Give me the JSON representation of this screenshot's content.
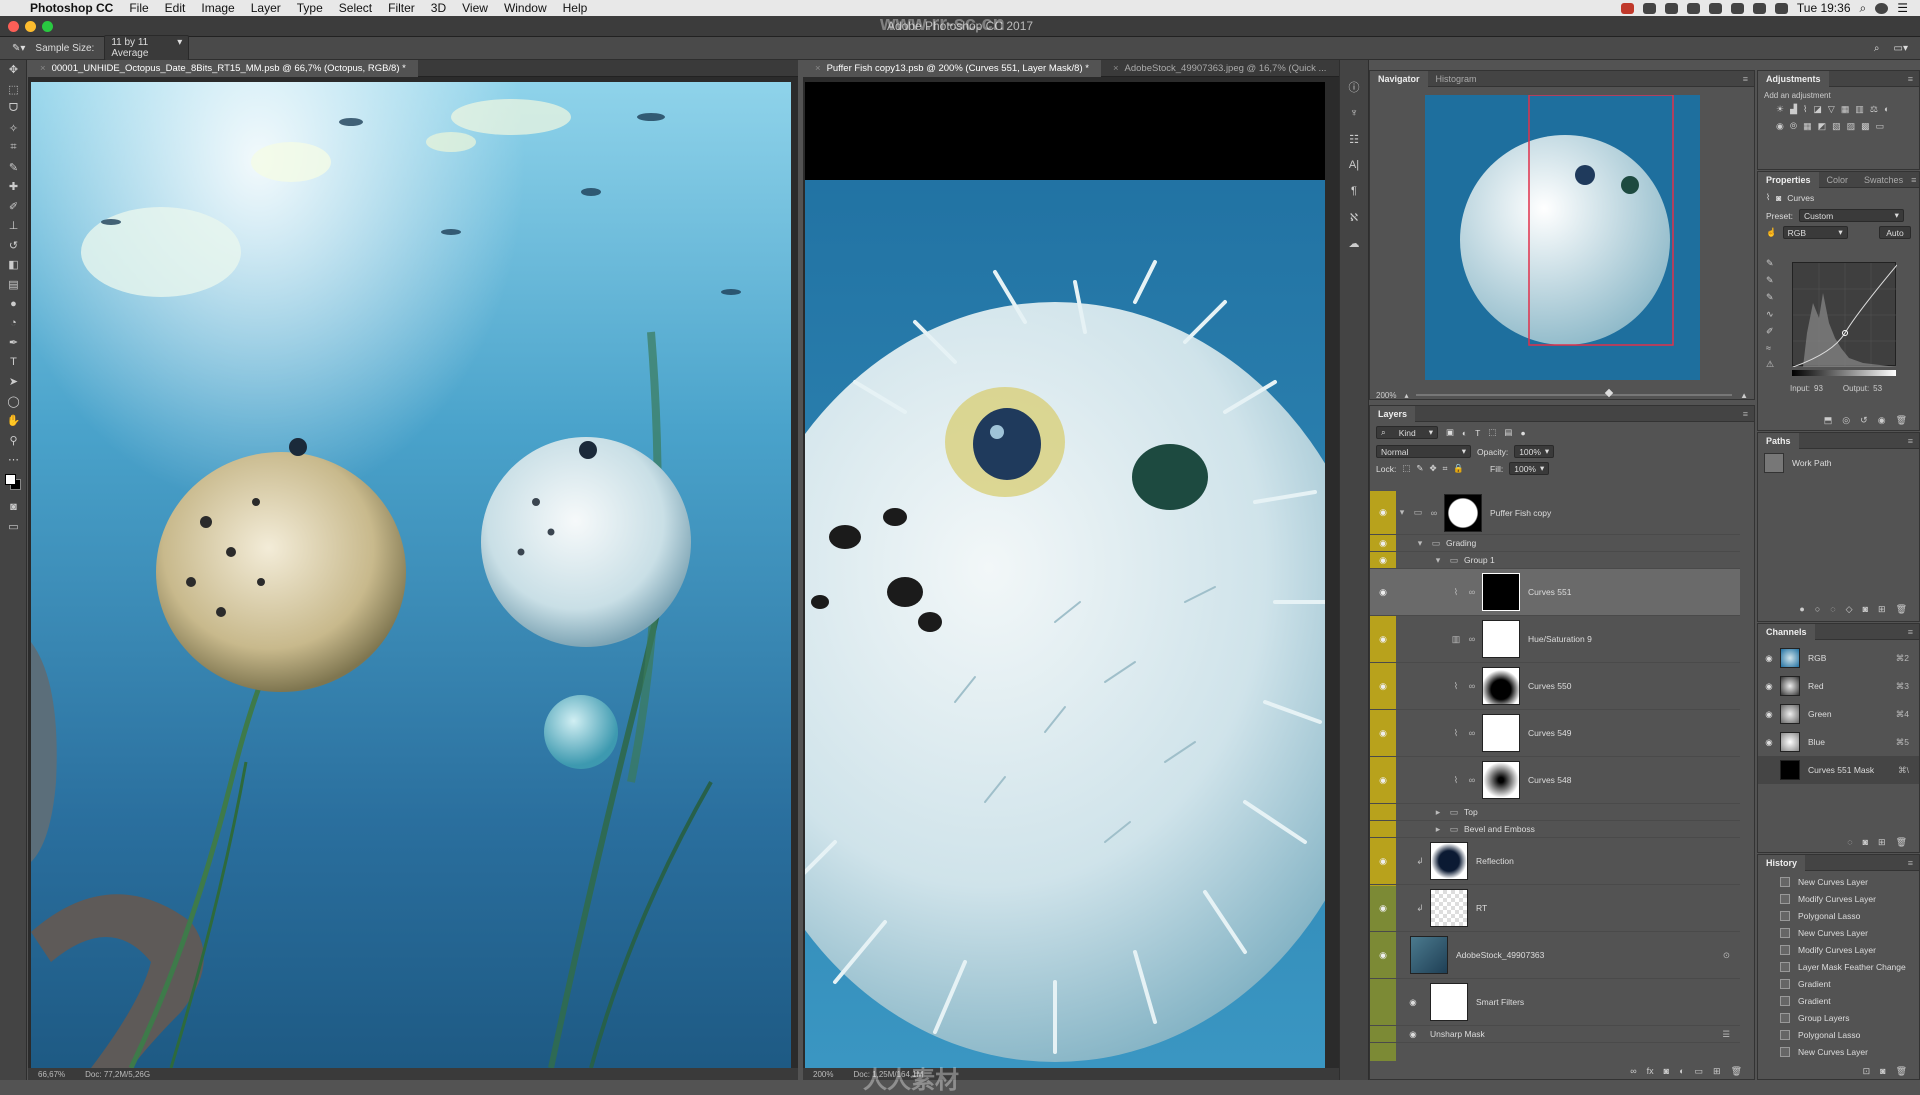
{
  "menubar": {
    "app": "Photoshop CC",
    "items": [
      "File",
      "Edit",
      "Image",
      "Layer",
      "Type",
      "Select",
      "Filter",
      "3D",
      "View",
      "Window",
      "Help"
    ],
    "clock": "Tue 19:36"
  },
  "window_title": "Adobe Photoshop CC 2017",
  "options_bar": {
    "sample_size_label": "Sample Size:",
    "sample_size_value": "11 by 11 Average"
  },
  "documents": [
    {
      "tab": "00001_UNHIDE_Octopus_Date_8Bits_RT15_MM.psb @ 66,7% (Octopus, RGB/8) *",
      "zoom": "66,67%",
      "doc_size": "Doc: 77,2M/5,26G"
    },
    {
      "tab": "Puffer Fish copy13.psb @ 200% (Curves 551, Layer Mask/8) *",
      "tab2": "AdobeStock_49907363.jpeg @ 16,7% (Quick ...",
      "zoom": "200%",
      "doc_size": "Doc: 1,25M/164,1M"
    }
  ],
  "navigator": {
    "tabs": [
      "Navigator",
      "Histogram"
    ],
    "zoom": "200%"
  },
  "adjustments": {
    "title": "Adjustments",
    "subtitle": "Add an adjustment"
  },
  "properties": {
    "tabs": [
      "Properties",
      "Color",
      "Swatches"
    ],
    "type": "Curves",
    "preset_label": "Preset:",
    "preset_value": "Custom",
    "channel": "RGB",
    "auto": "Auto",
    "input_label": "Input:",
    "input_value": "93",
    "output_label": "Output:",
    "output_value": "53"
  },
  "paths": {
    "title": "Paths",
    "items": [
      "Work Path"
    ]
  },
  "layers_panel": {
    "title": "Layers",
    "kind": "Kind",
    "blend": "Normal",
    "opacity_label": "Opacity:",
    "opacity": "100%",
    "lock_label": "Lock:",
    "fill_label": "Fill:",
    "fill": "100%",
    "layers": [
      {
        "name": "Puffer Fish copy",
        "type": "group-mask"
      },
      {
        "name": "Grading",
        "type": "folder"
      },
      {
        "name": "Group 1",
        "type": "folder"
      },
      {
        "name": "Curves 551",
        "type": "adjust",
        "selected": true
      },
      {
        "name": "Hue/Saturation 9",
        "type": "adjust"
      },
      {
        "name": "Curves 550",
        "type": "adjust"
      },
      {
        "name": "Curves 549",
        "type": "adjust"
      },
      {
        "name": "Curves 548",
        "type": "adjust"
      },
      {
        "name": "Top",
        "type": "folder"
      },
      {
        "name": "Bevel and Emboss",
        "type": "folder"
      },
      {
        "name": "Reflection",
        "type": "pixel"
      },
      {
        "name": "RT",
        "type": "pixel"
      },
      {
        "name": "AdobeStock_49907363",
        "type": "smart"
      },
      {
        "name": "Smart Filters",
        "type": "filters"
      },
      {
        "name": "Unsharp Mask",
        "type": "filter"
      }
    ]
  },
  "channels": {
    "title": "Channels",
    "items": [
      {
        "name": "RGB",
        "shortcut": "⌘2"
      },
      {
        "name": "Red",
        "shortcut": "⌘3"
      },
      {
        "name": "Green",
        "shortcut": "⌘4"
      },
      {
        "name": "Blue",
        "shortcut": "⌘5"
      },
      {
        "name": "Curves 551 Mask",
        "shortcut": "⌘\\"
      }
    ]
  },
  "history": {
    "title": "History",
    "items": [
      "New Curves Layer",
      "Modify Curves Layer",
      "Polygonal Lasso",
      "New Curves Layer",
      "Modify Curves Layer",
      "Layer Mask Feather Change",
      "Gradient",
      "Gradient",
      "Group Layers",
      "Polygonal Lasso",
      "New Curves Layer"
    ]
  },
  "watermarks": {
    "top": "www.rr-sc.cn",
    "bottom": "人人素材"
  },
  "colors": {
    "accent_layer_col": "#b8a21c",
    "ocean": "#2f86b8",
    "nav_frame": "#e0304a"
  }
}
